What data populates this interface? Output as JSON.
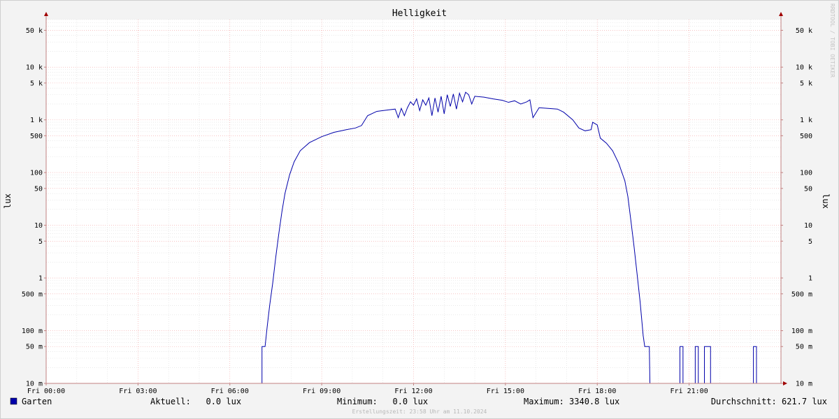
{
  "chart_data": {
    "type": "line",
    "title": "Helligkeit",
    "ylabel_left": "lux",
    "ylabel_right": "lux",
    "y_scale": "log",
    "ylim": [
      0.01,
      80000
    ],
    "xlim_hours": [
      0,
      24
    ],
    "x_tick_labels": [
      "Fri 00:00",
      "Fri 03:00",
      "Fri 06:00",
      "Fri 09:00",
      "Fri 12:00",
      "Fri 15:00",
      "Fri 18:00",
      "Fri 21:00"
    ],
    "x_tick_hours": [
      0,
      3,
      6,
      9,
      12,
      15,
      18,
      21
    ],
    "y_ticks": [
      {
        "value": 0.01,
        "label": "10 m"
      },
      {
        "value": 0.05,
        "label": "50 m"
      },
      {
        "value": 0.1,
        "label": "100 m"
      },
      {
        "value": 0.5,
        "label": "500 m"
      },
      {
        "value": 1,
        "label": "1"
      },
      {
        "value": 5,
        "label": "5"
      },
      {
        "value": 10,
        "label": "10"
      },
      {
        "value": 50,
        "label": "50"
      },
      {
        "value": 100,
        "label": "100"
      },
      {
        "value": 500,
        "label": "500"
      },
      {
        "value": 1000,
        "label": "1 k"
      },
      {
        "value": 5000,
        "label": "5 k"
      },
      {
        "value": 10000,
        "label": "10 k"
      },
      {
        "value": 50000,
        "label": "50 k"
      }
    ],
    "grid": true,
    "series": [
      {
        "name": "Garten",
        "color": "#0000aa",
        "points": [
          [
            0.0,
            0.01
          ],
          [
            7.05,
            0.01
          ],
          [
            7.05,
            0.05
          ],
          [
            7.15,
            0.05
          ],
          [
            7.22,
            0.12
          ],
          [
            7.3,
            0.3
          ],
          [
            7.4,
            0.8
          ],
          [
            7.5,
            2.5
          ],
          [
            7.6,
            7
          ],
          [
            7.7,
            18
          ],
          [
            7.8,
            40
          ],
          [
            7.95,
            90
          ],
          [
            8.1,
            160
          ],
          [
            8.3,
            260
          ],
          [
            8.6,
            370
          ],
          [
            9.0,
            480
          ],
          [
            9.4,
            580
          ],
          [
            9.8,
            650
          ],
          [
            10.1,
            700
          ],
          [
            10.3,
            780
          ],
          [
            10.5,
            1200
          ],
          [
            10.8,
            1450
          ],
          [
            11.2,
            1550
          ],
          [
            11.4,
            1600
          ],
          [
            11.5,
            1100
          ],
          [
            11.6,
            1650
          ],
          [
            11.7,
            1200
          ],
          [
            11.8,
            1700
          ],
          [
            11.9,
            2200
          ],
          [
            12.0,
            1900
          ],
          [
            12.1,
            2500
          ],
          [
            12.2,
            1500
          ],
          [
            12.3,
            2400
          ],
          [
            12.4,
            1900
          ],
          [
            12.5,
            2600
          ],
          [
            12.6,
            1200
          ],
          [
            12.7,
            2600
          ],
          [
            12.8,
            1400
          ],
          [
            12.9,
            2800
          ],
          [
            13.0,
            1300
          ],
          [
            13.1,
            3000
          ],
          [
            13.2,
            1800
          ],
          [
            13.3,
            3100
          ],
          [
            13.4,
            1600
          ],
          [
            13.5,
            3200
          ],
          [
            13.6,
            2200
          ],
          [
            13.7,
            3340.8
          ],
          [
            13.8,
            3000
          ],
          [
            13.9,
            2000
          ],
          [
            14.0,
            2800
          ],
          [
            14.3,
            2700
          ],
          [
            14.6,
            2500
          ],
          [
            14.9,
            2350
          ],
          [
            15.1,
            2150
          ],
          [
            15.3,
            2300
          ],
          [
            15.5,
            2000
          ],
          [
            15.7,
            2200
          ],
          [
            15.8,
            2400
          ],
          [
            15.9,
            1100
          ],
          [
            16.1,
            1700
          ],
          [
            16.4,
            1650
          ],
          [
            16.7,
            1600
          ],
          [
            16.9,
            1400
          ],
          [
            17.2,
            1000
          ],
          [
            17.4,
            700
          ],
          [
            17.6,
            620
          ],
          [
            17.8,
            650
          ],
          [
            17.85,
            900
          ],
          [
            18.0,
            800
          ],
          [
            18.1,
            450
          ],
          [
            18.3,
            360
          ],
          [
            18.5,
            260
          ],
          [
            18.7,
            150
          ],
          [
            18.9,
            70
          ],
          [
            19.0,
            35
          ],
          [
            19.1,
            12
          ],
          [
            19.2,
            4
          ],
          [
            19.3,
            1.2
          ],
          [
            19.4,
            0.35
          ],
          [
            19.5,
            0.08
          ],
          [
            19.55,
            0.05
          ],
          [
            19.7,
            0.05
          ],
          [
            19.72,
            0.01
          ],
          [
            20.7,
            0.01
          ],
          [
            20.7,
            0.05
          ],
          [
            20.8,
            0.05
          ],
          [
            20.8,
            0.01
          ],
          [
            21.2,
            0.01
          ],
          [
            21.2,
            0.05
          ],
          [
            21.3,
            0.05
          ],
          [
            21.3,
            0.01
          ],
          [
            21.5,
            0.01
          ],
          [
            21.5,
            0.05
          ],
          [
            21.7,
            0.05
          ],
          [
            21.7,
            0.01
          ],
          [
            23.1,
            0.01
          ],
          [
            23.1,
            0.05
          ],
          [
            23.2,
            0.05
          ],
          [
            23.2,
            0.01
          ],
          [
            24.0,
            0.01
          ]
        ]
      }
    ],
    "legend": {
      "swatch_color": "#0000aa",
      "name": "Garten",
      "aktuell": "Aktuell:   0.0 lux",
      "minimum": "Minimum:   0.0 lux",
      "maximum": "Maximum: 3340.8 lux",
      "durchschnitt": "Durchschnitt: 621.7 lux"
    },
    "footer": "Erstellungszeit: 23:58 Uhr am 11.10.2024",
    "watermark": "RRDTOOL / TOBI OETIKER"
  }
}
